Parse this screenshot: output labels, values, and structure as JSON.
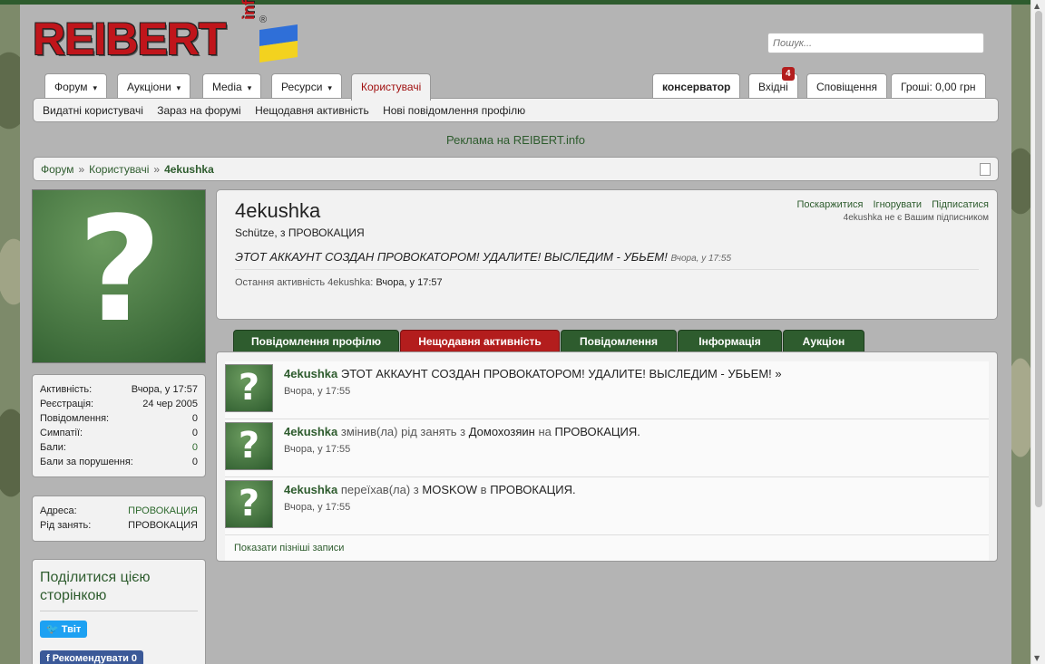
{
  "logo": {
    "text": "REIBERT",
    "info": "info",
    "reg": "®"
  },
  "search": {
    "placeholder": "Пошук..."
  },
  "nav": {
    "tabs": [
      "Форум",
      "Аукціони",
      "Media",
      "Ресурси",
      "Користувачі"
    ],
    "user": "консерватор",
    "inbox": "Вхідні",
    "inbox_badge": "4",
    "alerts": "Сповіщення",
    "money": "Гроші: 0,00 грн"
  },
  "subnav": [
    "Видатні користувачі",
    "Зараз на форумі",
    "Нещодавня активність",
    "Нові повідомлення профілю"
  ],
  "ad": "Реклама на REIBERT.info",
  "breadcrumb": {
    "items": [
      "Форум",
      "Користувачі"
    ],
    "current": "4ekushka",
    "sep": "»"
  },
  "avatar_glyph": "?",
  "stats": [
    {
      "label": "Активність:",
      "value": "Вчора, у 17:57"
    },
    {
      "label": "Реєстрація:",
      "value": "24 чер 2005"
    },
    {
      "label": "Повідомлення:",
      "value": "0"
    },
    {
      "label": "Симпатії:",
      "value": "0"
    },
    {
      "label": "Бали:",
      "value": "0"
    },
    {
      "label": "Бали за порушення:",
      "value": "0"
    }
  ],
  "address": [
    {
      "label": "Адреса:",
      "value": "ПРОВОКАЦИЯ"
    },
    {
      "label": "Рід занять:",
      "value": "ПРОВОКАЦИЯ"
    }
  ],
  "share": {
    "title": "Поділитися цією сторінкою",
    "tweet": "Твіт",
    "fb": "Рекомендувати 0"
  },
  "profile": {
    "name": "4ekushka",
    "title": "Schütze, з ПРОВОКАЦИЯ",
    "status": "ЭТОТ АККАУНТ СОЗДАН ПРОВОКАТОРОМ! УДАЛИТЕ! ВЫСЛЕДИМ - УБЬЕМ!",
    "status_time": "Вчора, у 17:55",
    "last_label": "Остання активність 4ekushka:",
    "last_value": "Вчора, у 17:57",
    "actions": [
      "Поскаржитися",
      "Ігнорувати",
      "Підписатися"
    ],
    "sub_note": "4ekushka не є Вашим підписником"
  },
  "profile_tabs": [
    "Повідомлення профілю",
    "Нещодавня активність",
    "Повідомлення",
    "Інформація",
    "Аукціон"
  ],
  "feed": [
    {
      "user": "4ekushka",
      "parts": [
        " ЭТОТ АККАУНТ СОЗДАН ПРОВОКАТОРОМ! УДАЛИТЕ! ВЫСЛЕДИМ - УБЬЕМ! »"
      ],
      "time": "Вчора, у 17:55"
    },
    {
      "user": "4ekushka",
      "parts": [
        " змінив(ла) рід занять з ",
        "Домохозяин",
        " на ",
        "ПРОВОКАЦИЯ."
      ],
      "time": "Вчора, у 17:55"
    },
    {
      "user": "4ekushka",
      "parts": [
        " переїхав(ла) з ",
        "MOSKOW",
        " в ",
        "ПРОВОКАЦИЯ."
      ],
      "time": "Вчора, у 17:55"
    }
  ],
  "show_more": "Показати пізніші записи",
  "colors": {
    "accent": "#2e5c2e",
    "active_tab": "#b31d1d",
    "brand_red": "#c0151b"
  }
}
